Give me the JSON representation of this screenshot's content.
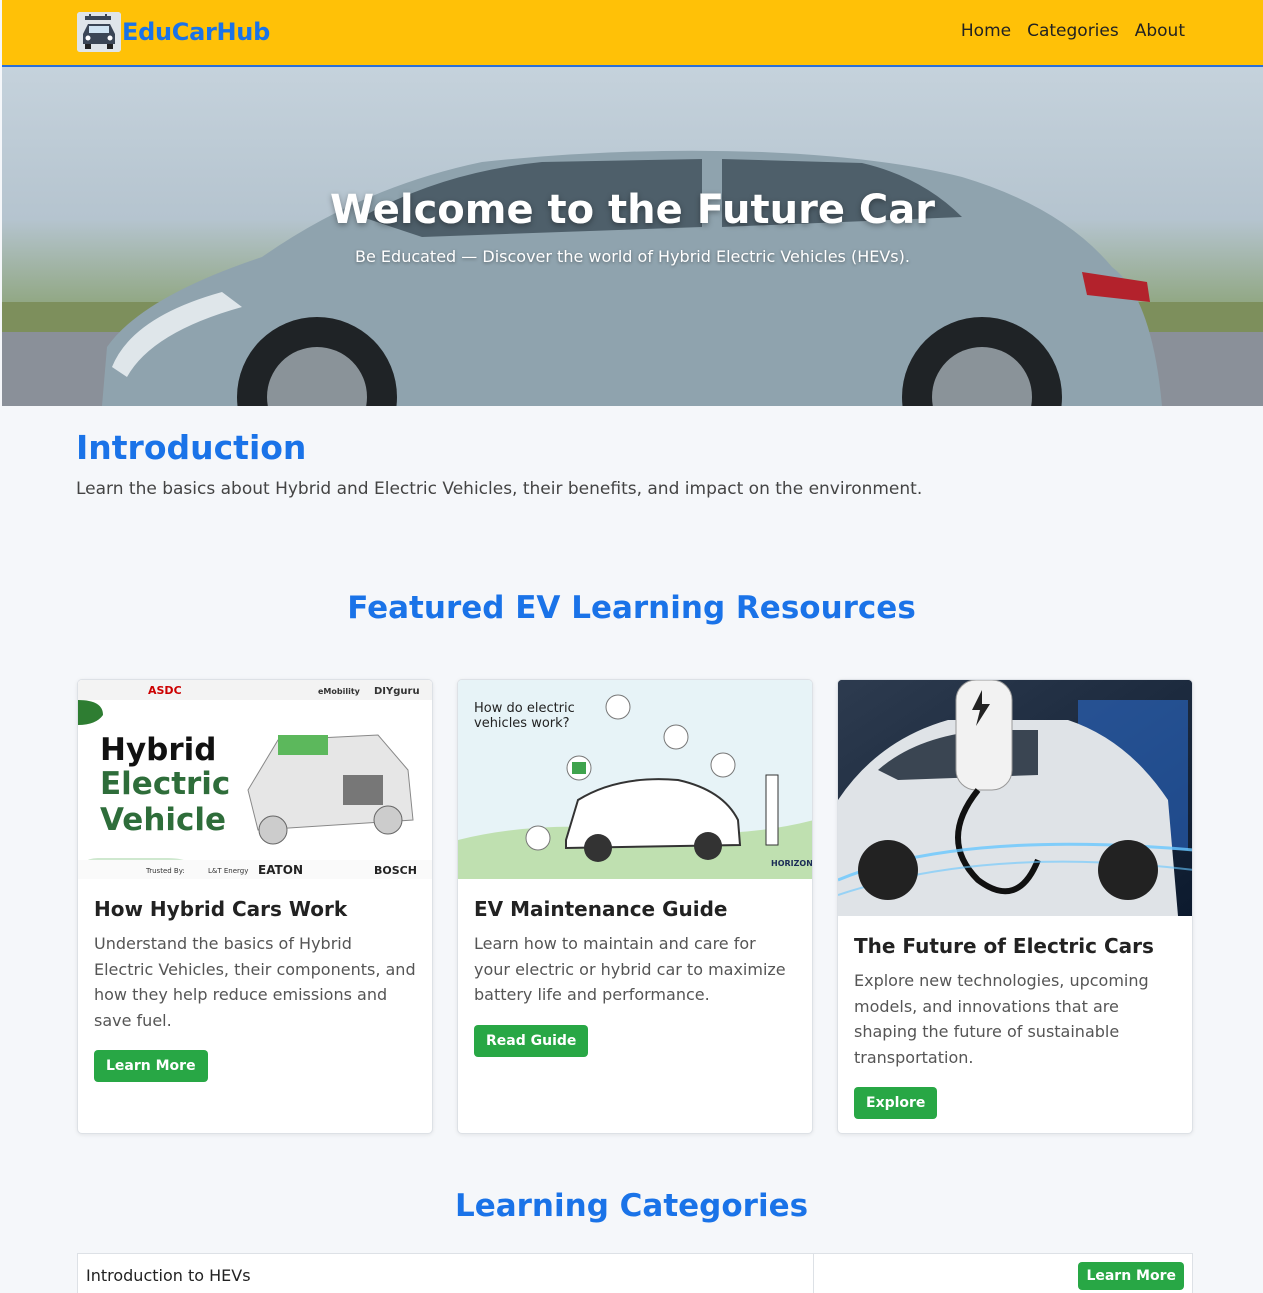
{
  "nav": {
    "brand": "EduCarHub",
    "links": [
      "Home",
      "Categories",
      "About"
    ]
  },
  "hero": {
    "title": "Welcome to the Future Car",
    "subtitle": "Be Educated — Discover the world of Hybrid Electric Vehicles (HEVs)."
  },
  "intro": {
    "heading": "Introduction",
    "text": "Learn the basics about Hybrid and Electric Vehicles, their benefits, and impact on the environment."
  },
  "featured": {
    "heading": "Featured EV Learning Resources",
    "cards": [
      {
        "title": "How Hybrid Cars Work",
        "text": "Understand the basics of Hybrid Electric Vehicles, their components, and how they help reduce emissions and save fuel.",
        "button": "Learn More",
        "image_text": [
          "Hybrid",
          "Electric",
          "Vehicle"
        ],
        "image_header": [
          "ASDC",
          "eMobility",
          "DIYguru"
        ],
        "image_footer": [
          "Trusted By:",
          "L&T Energy",
          "EATON",
          "BOSCH"
        ]
      },
      {
        "title": "EV Maintenance Guide",
        "text": "Learn how to maintain and care for your electric or hybrid car to maximize battery life and performance.",
        "button": "Read Guide",
        "image_text": [
          "How do electric",
          "vehicles work?"
        ],
        "image_footer": [
          "HORIZON"
        ]
      },
      {
        "title": "The Future of Electric Cars",
        "text": "Explore new technologies, upcoming models, and innovations that are shaping the future of sustainable transportation.",
        "button": "Explore"
      }
    ]
  },
  "categories": {
    "heading": "Learning Categories",
    "rows": [
      {
        "name": "Introduction to HEVs",
        "button": "Learn More"
      }
    ]
  },
  "colors": {
    "navbar": "#ffc107",
    "accent": "#1a73e8",
    "button": "#28a745",
    "background": "#f5f7fa"
  },
  "icons": [
    "car-logo-icon",
    "charging-bolt-icon"
  ]
}
